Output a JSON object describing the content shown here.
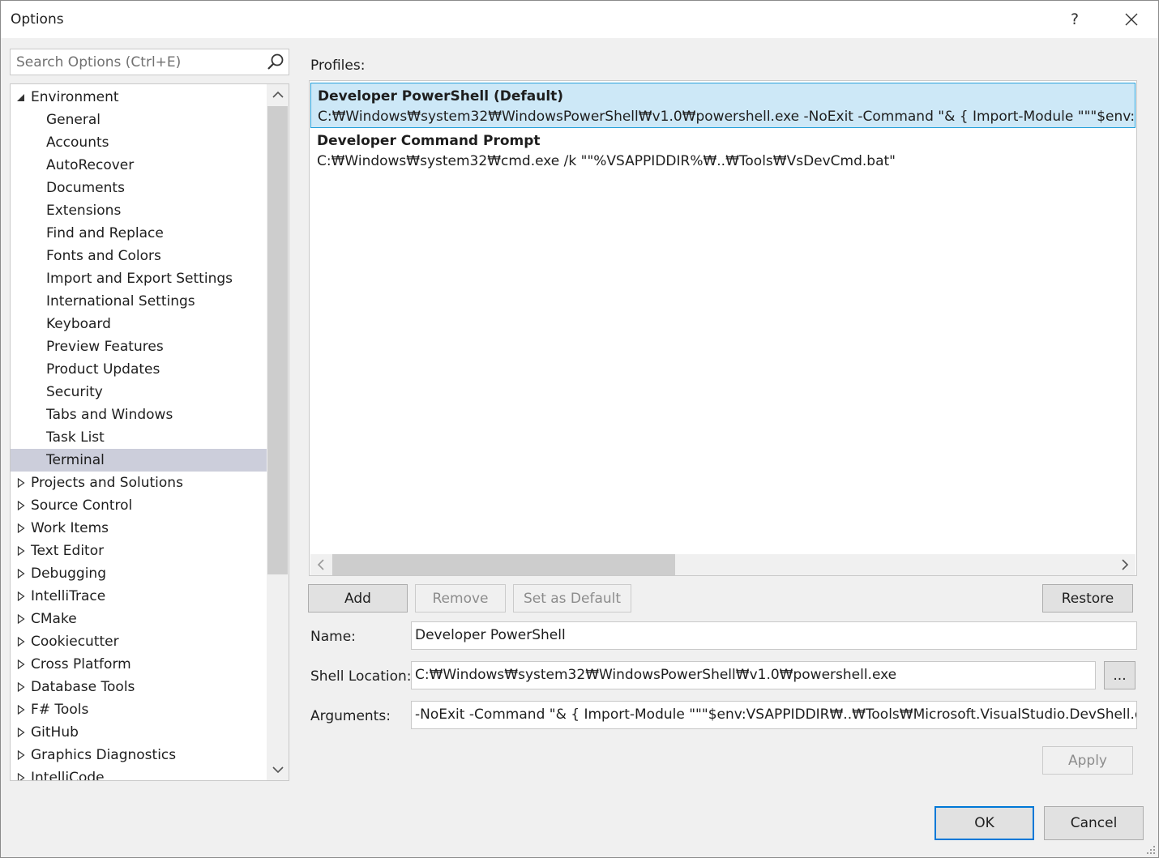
{
  "window": {
    "title": "Options",
    "help_glyph": "?",
    "close_glyph": "✕"
  },
  "search": {
    "placeholder": "Search Options (Ctrl+E)",
    "icon": "search-icon"
  },
  "tree": {
    "environment_label": "Environment",
    "environment_children": [
      "General",
      "Accounts",
      "AutoRecover",
      "Documents",
      "Extensions",
      "Find and Replace",
      "Fonts and Colors",
      "Import and Export Settings",
      "International Settings",
      "Keyboard",
      "Preview Features",
      "Product Updates",
      "Security",
      "Tabs and Windows",
      "Task List",
      "Terminal"
    ],
    "selected": "Terminal",
    "collapsed_groups": [
      "Projects and Solutions",
      "Source Control",
      "Work Items",
      "Text Editor",
      "Debugging",
      "IntelliTrace",
      "CMake",
      "Cookiecutter",
      "Cross Platform",
      "Database Tools",
      "F# Tools",
      "GitHub",
      "Graphics Diagnostics",
      "IntelliCode"
    ]
  },
  "profiles": {
    "label": "Profiles:",
    "items": [
      {
        "name": "Developer PowerShell (Default)",
        "command": "C:₩Windows₩system32₩WindowsPowerShell₩v1.0₩powershell.exe -NoExit -Command \"& { Import-Module \"\"\"$env:VSAPPIDDIR₩..₩Tools₩Microsoft.VisualStudio.DevShell.dll\"\"\"",
        "selected": true
      },
      {
        "name": "Developer Command Prompt",
        "command": "C:₩Windows₩system32₩cmd.exe /k \"\"%VSAPPIDDIR%₩..₩Tools₩VsDevCmd.bat\"",
        "selected": false
      }
    ]
  },
  "buttons": {
    "add": "Add",
    "remove": "Remove",
    "set_default": "Set as Default",
    "restore": "Restore",
    "browse": "...",
    "apply": "Apply",
    "ok": "OK",
    "cancel": "Cancel"
  },
  "fields": {
    "name_label": "Name:",
    "name_value": "Developer PowerShell",
    "shell_label": "Shell Location:",
    "shell_value": "C:₩Windows₩system32₩WindowsPowerShell₩v1.0₩powershell.exe",
    "args_label": "Arguments:",
    "args_value": "-NoExit -Command \"& { Import-Module \"\"\"$env:VSAPPIDDIR₩..₩Tools₩Microsoft.VisualStudio.DevShell.dll\"\"\"; Enter-VsDevShell"
  },
  "colors": {
    "accent": "#0078d7",
    "tree_selected": "#cccedb",
    "profile_selected": "#cde8f7"
  }
}
